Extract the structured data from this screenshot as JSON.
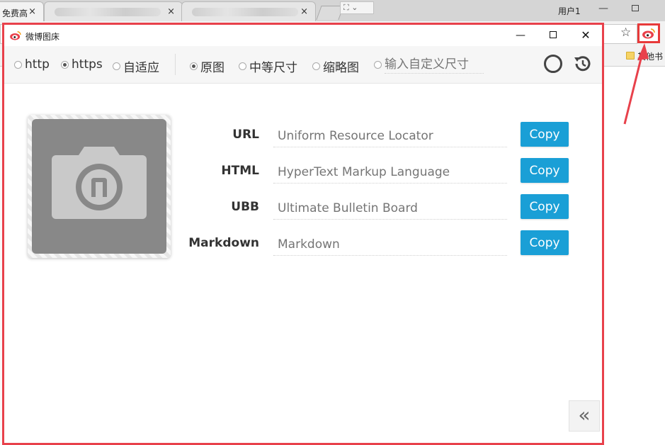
{
  "browser": {
    "tabs": [
      {
        "label": "免费高",
        "close": "×"
      },
      {
        "label": "",
        "close": "×"
      },
      {
        "label": "",
        "close": "×"
      }
    ],
    "user_label": "用户1",
    "bookmark_label": "其他书"
  },
  "popup": {
    "title": "微博图床",
    "controls": {
      "minimize": "—",
      "close": "✕"
    }
  },
  "toolbar": {
    "protocol_options": [
      {
        "label": "http",
        "checked": false
      },
      {
        "label": "https",
        "checked": true
      },
      {
        "label": "自适应",
        "checked": false
      }
    ],
    "size_options": [
      {
        "label": "原图",
        "checked": true
      },
      {
        "label": "中等尺寸",
        "checked": false
      },
      {
        "label": "缩略图",
        "checked": false
      }
    ],
    "custom_size_placeholder": "输入自定义尺寸"
  },
  "links": [
    {
      "label": "URL",
      "placeholder": "Uniform Resource Locator",
      "button": "Copy"
    },
    {
      "label": "HTML",
      "placeholder": "HyperText Markup Language",
      "button": "Copy"
    },
    {
      "label": "UBB",
      "placeholder": "Ultimate Bulletin Board",
      "button": "Copy"
    },
    {
      "label": "Markdown",
      "placeholder": "Markdown",
      "button": "Copy"
    }
  ],
  "collapse_label": "«",
  "colors": {
    "accent": "#1a9fd6",
    "highlight_border": "#e8414b",
    "upload_bg": "#888888"
  },
  "icons": [
    "weibo-logo-icon",
    "camera-icon",
    "circle-icon",
    "history-icon",
    "star-icon",
    "folder-icon"
  ]
}
